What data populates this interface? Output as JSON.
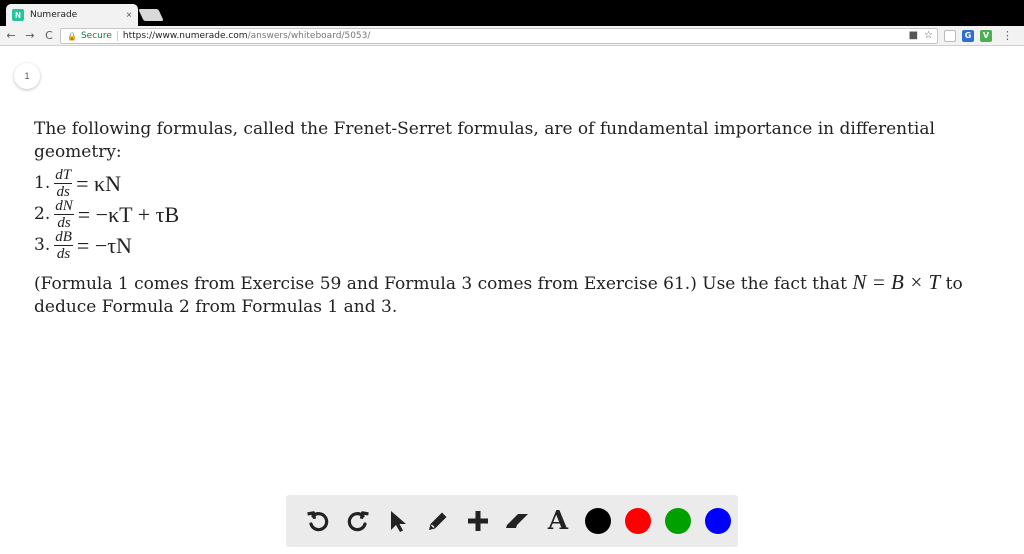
{
  "browser": {
    "tab_title": "Numerade",
    "tab_favicon": "N",
    "tab_close": "×",
    "back": "←",
    "forward": "→",
    "reload": "C",
    "secure_label": "Secure",
    "url_protocol": "https://www.numerade.com",
    "url_path": "/answers/whiteboard/5053/",
    "ext_g": "G",
    "ext_v": "V"
  },
  "whiteboard": {
    "page_number": "1",
    "intro": "The following formulas, called the Frenet-Serret formulas, are of fundamental importance in differential geometry:",
    "formulas": [
      {
        "number": "1.",
        "num": "dT",
        "den": "ds",
        "rhs": "= κN"
      },
      {
        "number": "2.",
        "num": "dN",
        "den": "ds",
        "rhs": "= −κT + τB"
      },
      {
        "number": "3.",
        "num": "dB",
        "den": "ds",
        "rhs": "= −τN"
      }
    ],
    "para_before": "(Formula 1 comes from Exercise 59 and Formula 3 comes from Exercise 61.) Use the fact that ",
    "para_math": "N = B × T",
    "para_after": " to deduce Formula 2 from Formulas 1 and 3."
  },
  "drawbar": {
    "text_tool": "A",
    "colors": [
      "#000000",
      "#ff0000",
      "#00a000",
      "#0000ff"
    ]
  }
}
